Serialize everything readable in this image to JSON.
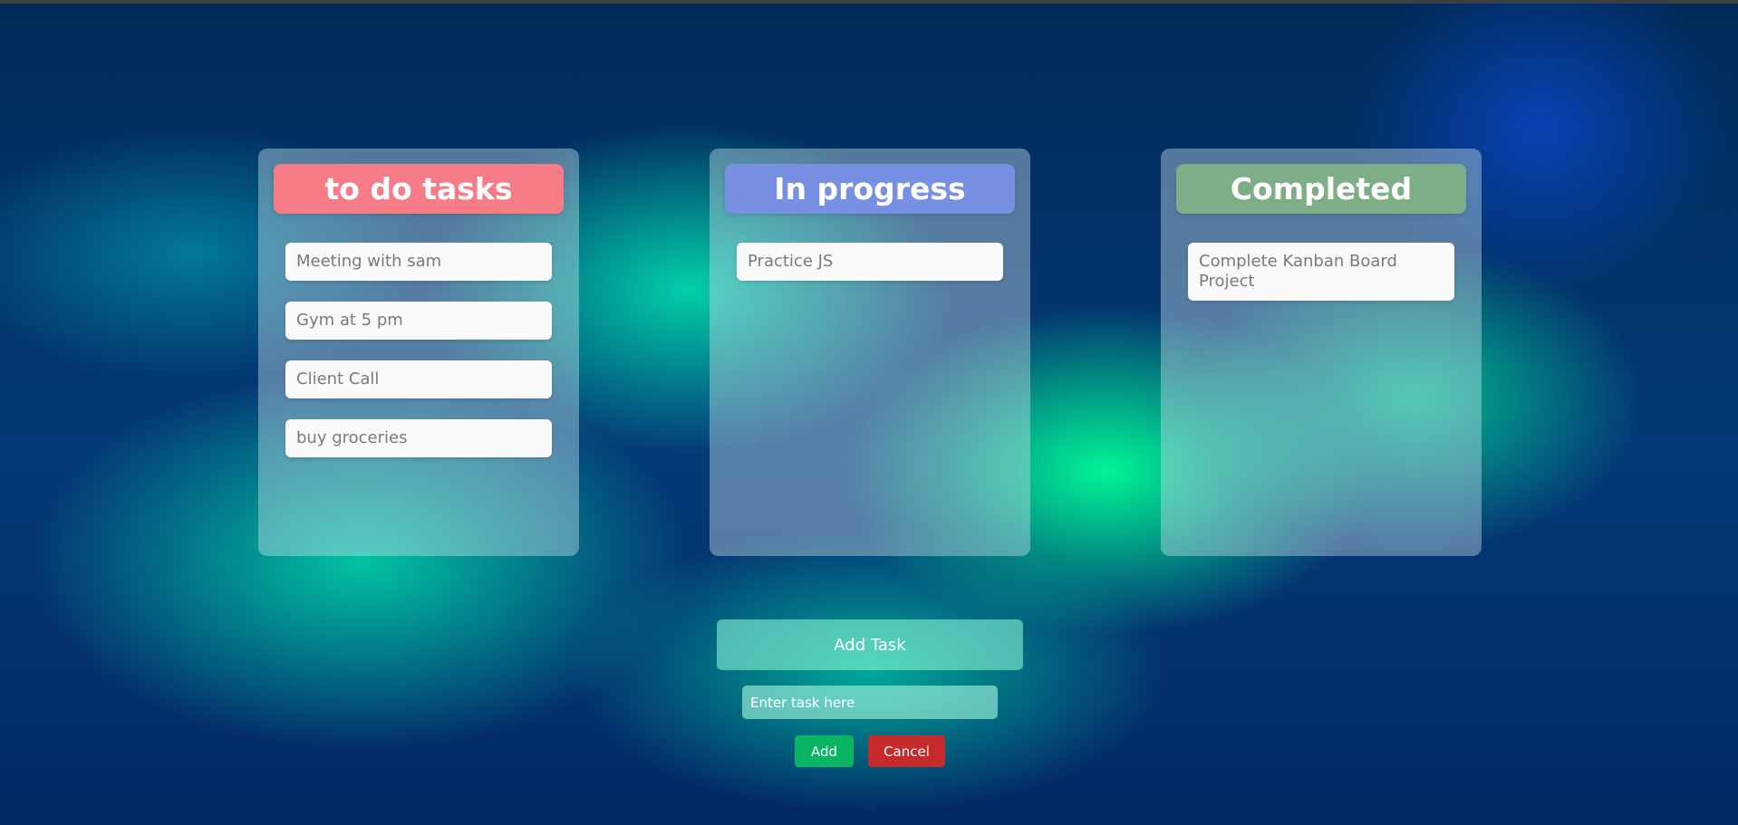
{
  "colors": {
    "todo_header": "#f67c87",
    "progress_header": "#7790e3",
    "completed_header": "#7eae87",
    "add_button": "#09b463",
    "cancel_button": "#c62a2b"
  },
  "columns": [
    {
      "title": "to do tasks",
      "tasks": [
        "Meeting with sam",
        "Gym at 5 pm",
        "Client Call",
        "buy groceries"
      ]
    },
    {
      "title": "In progress",
      "tasks": [
        "Practice JS"
      ]
    },
    {
      "title": "Completed",
      "tasks": [
        "Complete Kanban Board Project"
      ]
    }
  ],
  "form": {
    "toggle_label": "Add Task",
    "input_placeholder": "Enter task here",
    "input_value": "",
    "add_label": "Add",
    "cancel_label": "Cancel"
  }
}
